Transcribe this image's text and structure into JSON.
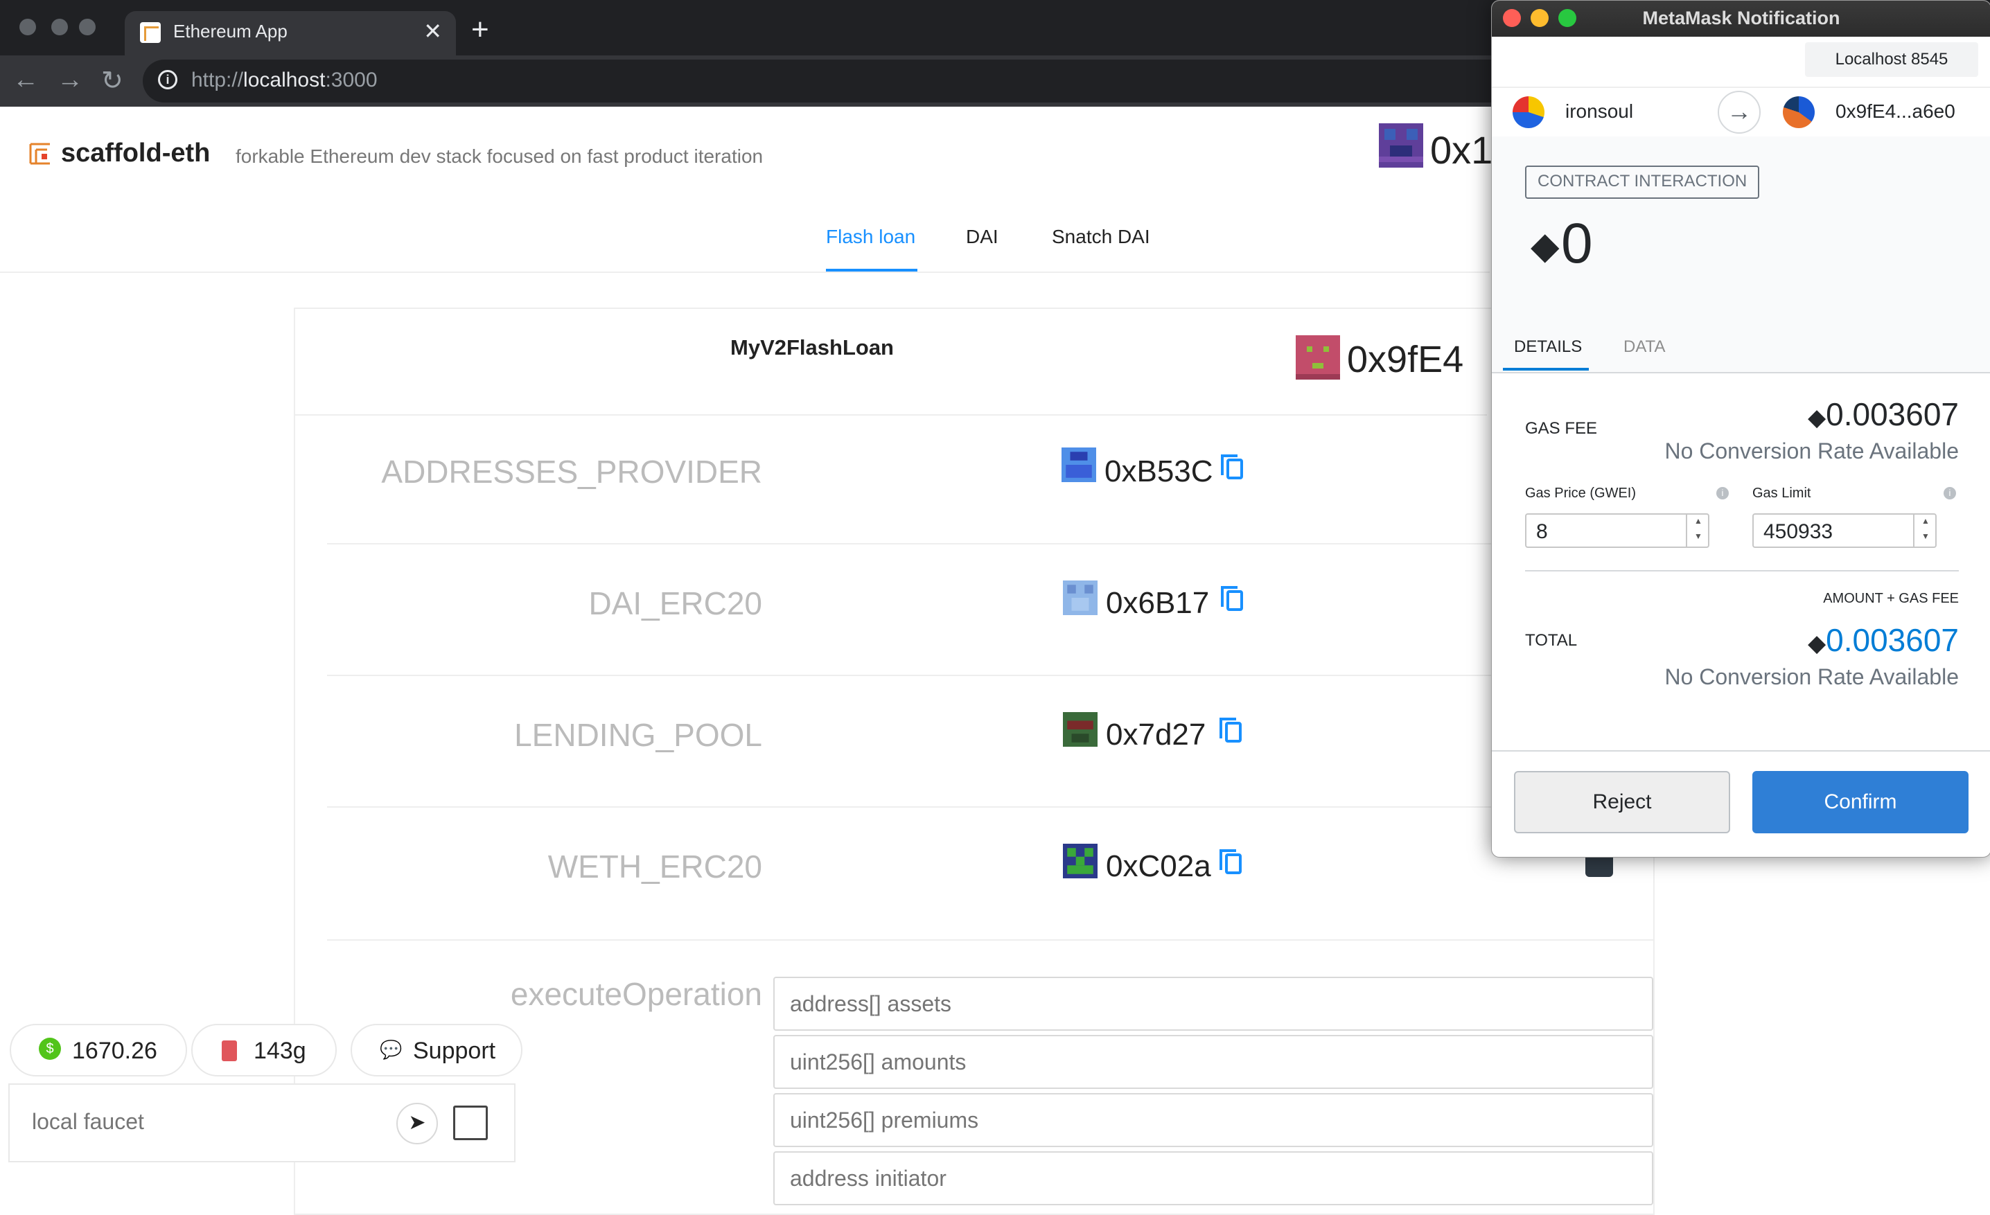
{
  "browser": {
    "tab_title": "Ethereum App",
    "url_scheme": "http://",
    "url_host": "localhost",
    "url_port": ":3000"
  },
  "app": {
    "brand": "scaffold-eth",
    "tagline": "forkable Ethereum dev stack focused on fast product iteration",
    "header_address": "0x1",
    "tabs": [
      "Flash loan",
      "DAI",
      "Snatch DAI"
    ],
    "contract": {
      "name": "MyV2FlashLoan",
      "address": "0x9fE4",
      "rows": [
        {
          "label": "ADDRESSES_PROVIDER",
          "address": "0xB53C"
        },
        {
          "label": "DAI_ERC20",
          "address": "0x6B17"
        },
        {
          "label": "LENDING_POOL",
          "address": "0x7d27"
        },
        {
          "label": "WETH_ERC20",
          "address": "0xC02a"
        }
      ],
      "execute": {
        "label": "executeOperation",
        "placeholders": [
          "address[] assets",
          "uint256[] amounts",
          "uint256[] premiums",
          "address initiator"
        ]
      }
    },
    "widgets": {
      "price": "1670.26",
      "gas": "143g",
      "support": "Support",
      "faucet_placeholder": "local faucet"
    }
  },
  "metamask": {
    "window_title": "MetaMask Notification",
    "network": "Localhost 8545",
    "from_account": "ironsoul",
    "to_address": "0x9fE4...a6e0",
    "badge": "CONTRACT INTERACTION",
    "amount": "0",
    "tabs": {
      "details": "DETAILS",
      "data": "DATA"
    },
    "gas_fee_label": "GAS FEE",
    "gas_fee_value": "0.003607",
    "no_conversion": "No Conversion Rate Available",
    "gas_price_label": "Gas Price (GWEI)",
    "gas_price_value": "8",
    "gas_limit_label": "Gas Limit",
    "gas_limit_value": "450933",
    "amount_plus_gas_label": "AMOUNT + GAS FEE",
    "total_label": "TOTAL",
    "total_value": "0.003607",
    "reject_label": "Reject",
    "confirm_label": "Confirm",
    "accent_color": "#037dd6"
  }
}
